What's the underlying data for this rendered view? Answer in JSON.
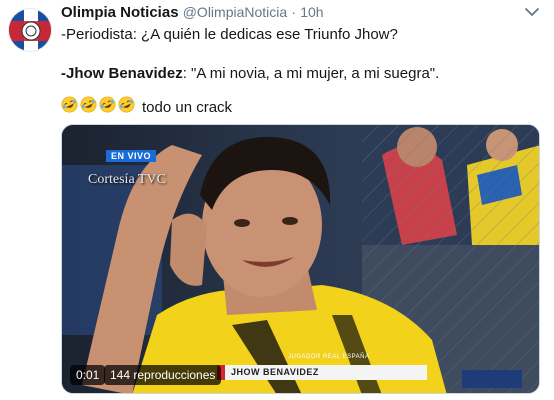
{
  "tweet": {
    "display_name": "Olimpia Noticias",
    "handle": "@OlimpiaNoticia",
    "separator": "·",
    "time": "10h",
    "line1": "-Periodista: ¿A quién le dedicas ese Triunfo Jhow?",
    "line2_bold": "-Jhow Benavidez",
    "line2_rest": ": \"A mi novia, a mi mujer, a mi suegra\".",
    "line3_suffix": "todo un crack",
    "emoji_name": "rolling-on-floor-laughing",
    "emoji_count": 4
  },
  "video": {
    "live_badge": "EN VIVO",
    "courtesy": "Cortesía TVC",
    "lower_third_name": "JHOW BENAVIDEZ",
    "lower_third_role": "JUGADOR REAL ESPAÑA",
    "elapsed": "0:01",
    "views": "144 reproducciones"
  },
  "colors": {
    "brand_red": "#d9242b",
    "brand_blue": "#1a4fa0",
    "jersey_yellow": "#f2d21b",
    "text_secondary": "#657786"
  }
}
